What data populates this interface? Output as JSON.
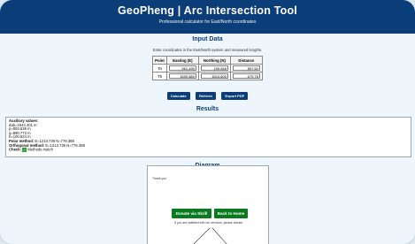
{
  "header": {
    "title": "GeoPheng | Arc Intersection Tool",
    "subtitle": "Professional calculator for East/North coordinates"
  },
  "input": {
    "title": "Input Data",
    "hint": "Enter coordinates in the East/North system and measured lengths.",
    "columns": [
      "Point",
      "Easting (E)",
      "Northing (N)",
      "Distance"
    ],
    "rows": [
      {
        "point": "Ta",
        "easting": "561.490",
        "northing": "150.648",
        "distance": "897.50"
      },
      {
        "point": "Tb",
        "easting": "1690.680",
        "northing": "1624.605",
        "distance": "679.78"
      }
    ],
    "buttons": {
      "calculate": "Calculate",
      "refresh": "Refresh",
      "export": "Export PDF"
    }
  },
  "results": {
    "title": "Results",
    "aux_label": "Auxiliary values:",
    "lines": [
      "dab=1544.401 m",
      "p=893.636 m",
      "q=890.773 m",
      "h=100.824 m"
    ],
    "polar_label": "Polar method:",
    "polar_value": "E=1213.736 N=776.388",
    "ortho_label": "Orthogonal method:",
    "ortho_value": "E=1213.736 N=776.388",
    "check_label": "Check:",
    "check_text": "Methods match"
  },
  "diagram": {
    "title": "Diagram",
    "thank_text": "Thank you",
    "donate_label": "Donate via Skrill",
    "home_label": "Back to Home",
    "note": "If you are satisfied with our services, please donate."
  },
  "colors": {
    "brand": "#0b3d78",
    "green": "#0a7a1e",
    "check": "#2e9e2e"
  }
}
